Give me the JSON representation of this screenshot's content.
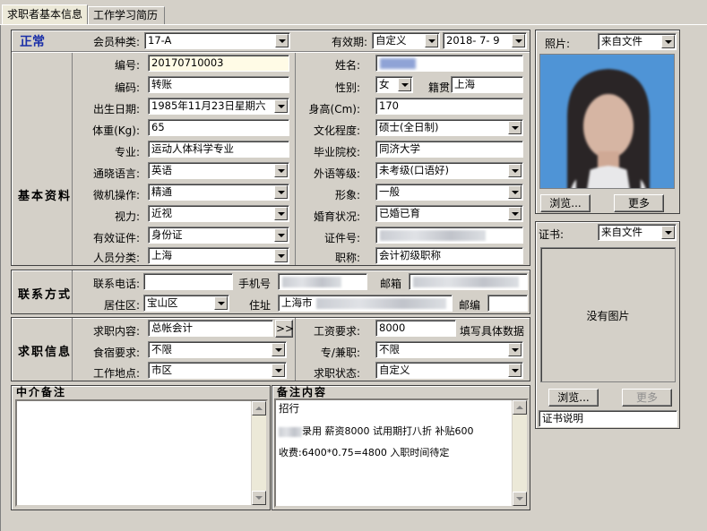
{
  "tabs": [
    {
      "label": "求职者基本信息",
      "active": true
    },
    {
      "label": "工作学习简历",
      "active": false
    }
  ],
  "header": {
    "status": "正常",
    "member_type_label": "会员种类:",
    "member_type_value": "17-A",
    "validity_label": "有效期:",
    "validity_value": "自定义",
    "date_value": "2018- 7- 9"
  },
  "basic": {
    "section_title": "基本资料",
    "number_label": "编号:",
    "number_value": "20170710003",
    "name_label": "姓名:",
    "code_label": "编码:",
    "code_value": "转账",
    "gender_label": "性别:",
    "gender_value": "女",
    "native_label": "籍贯",
    "native_value": "上海",
    "birth_label": "出生日期:",
    "birth_value": "1985年11月23日星期六",
    "height_label": "身高(Cm):",
    "height_value": "170",
    "weight_label": "体重(Kg):",
    "weight_value": "65",
    "education_label": "文化程度:",
    "education_value": "硕士(全日制)",
    "major_label": "专业:",
    "major_value": "运动人体科学专业",
    "school_label": "毕业院校:",
    "school_value": "同济大学",
    "language_label": "通晓语言:",
    "language_value": "英语",
    "lang_level_label": "外语等级:",
    "lang_level_value": "未考级(口语好)",
    "computer_label": "微机操作:",
    "computer_value": "精通",
    "image_label": "形象:",
    "image_value": "一般",
    "vision_label": "视力:",
    "vision_value": "近视",
    "marital_label": "婚育状况:",
    "marital_value": "已婚已育",
    "id_type_label": "有效证件:",
    "id_type_value": "身份证",
    "id_no_label": "证件号:",
    "category_label": "人员分类:",
    "category_value": "上海",
    "title_label": "职称:",
    "title_value": "会计初级职称"
  },
  "contact": {
    "section_title": "联系方式",
    "phone_label": "联系电话:",
    "mobile_label": "手机号",
    "email_label": "邮箱",
    "district_label": "居住区:",
    "district_value": "宝山区",
    "address_label": "住址",
    "address_value": "上海市",
    "postcode_label": "邮编"
  },
  "job": {
    "section_title": "求职信息",
    "content_label": "求职内容:",
    "content_value": "总帐会计",
    "more_btn": ">>",
    "salary_label": "工资要求:",
    "salary_value": "8000",
    "salary_hint": "填写具体数据",
    "board_label": "食宿要求:",
    "board_value": "不限",
    "fulltime_label": "专/兼职:",
    "fulltime_value": "不限",
    "location_label": "工作地点:",
    "location_value": "市区",
    "status_label": "求职状态:",
    "status_value": "自定义"
  },
  "notes": {
    "agency_title": "中介备注",
    "remark_title": "备注内容",
    "remark_lines": [
      "招行",
      "录用 薪资8000 试用期打八折 补贴600",
      "收费:6400*0.75=4800 入职时间待定"
    ]
  },
  "photo": {
    "label": "照片:",
    "source_value": "来自文件",
    "browse_btn": "浏览...",
    "more_btn": "更多"
  },
  "cert": {
    "label": "证书:",
    "source_value": "来自文件",
    "no_image": "没有图片",
    "browse_btn": "浏览...",
    "more_btn": "更多",
    "desc_value": "证书说明"
  }
}
